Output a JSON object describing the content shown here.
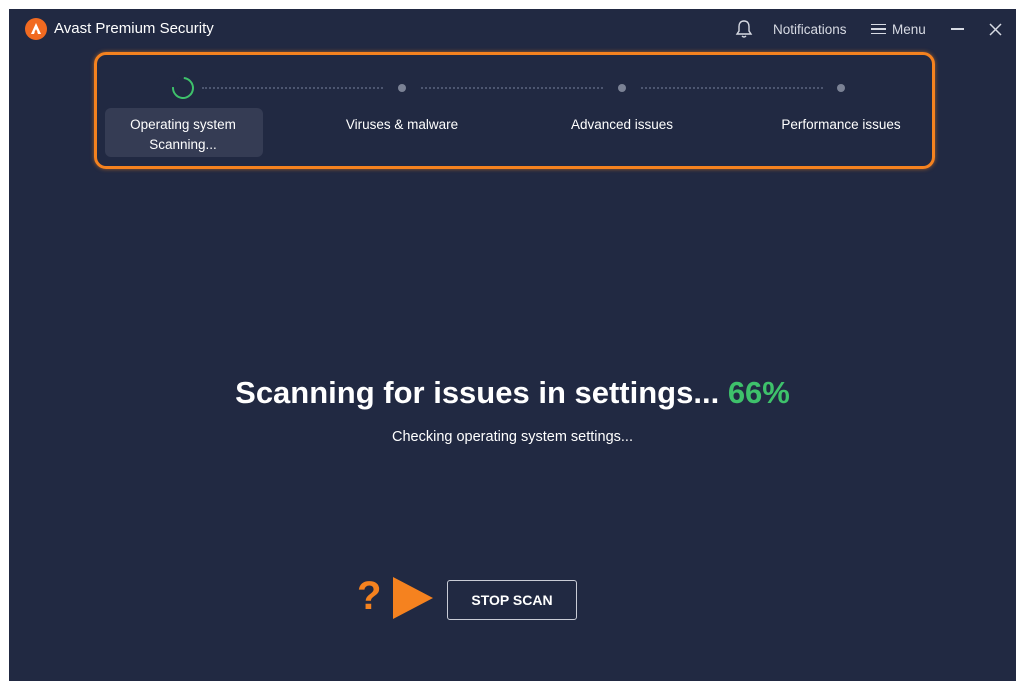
{
  "window": {
    "title": "Avast Premium Security",
    "notifications_label": "Notifications",
    "menu_label": "Menu"
  },
  "steps": [
    {
      "label": "Operating system",
      "status": "Scanning..."
    },
    {
      "label": "Viruses & malware"
    },
    {
      "label": "Advanced issues"
    },
    {
      "label": "Performance issues"
    }
  ],
  "scan": {
    "headline": "Scanning for issues in settings...",
    "percent": "66%",
    "detail": "Checking operating system settings...",
    "stop_label": "STOP SCAN"
  },
  "annotation": {
    "question": "?"
  },
  "colors": {
    "background": "#212942",
    "accent_orange": "#f5821f",
    "progress_green": "#3ec16b"
  },
  "icons": [
    "avast-logo-icon",
    "bell-icon",
    "hamburger-icon",
    "minimize-icon",
    "close-icon",
    "spinner-icon"
  ]
}
